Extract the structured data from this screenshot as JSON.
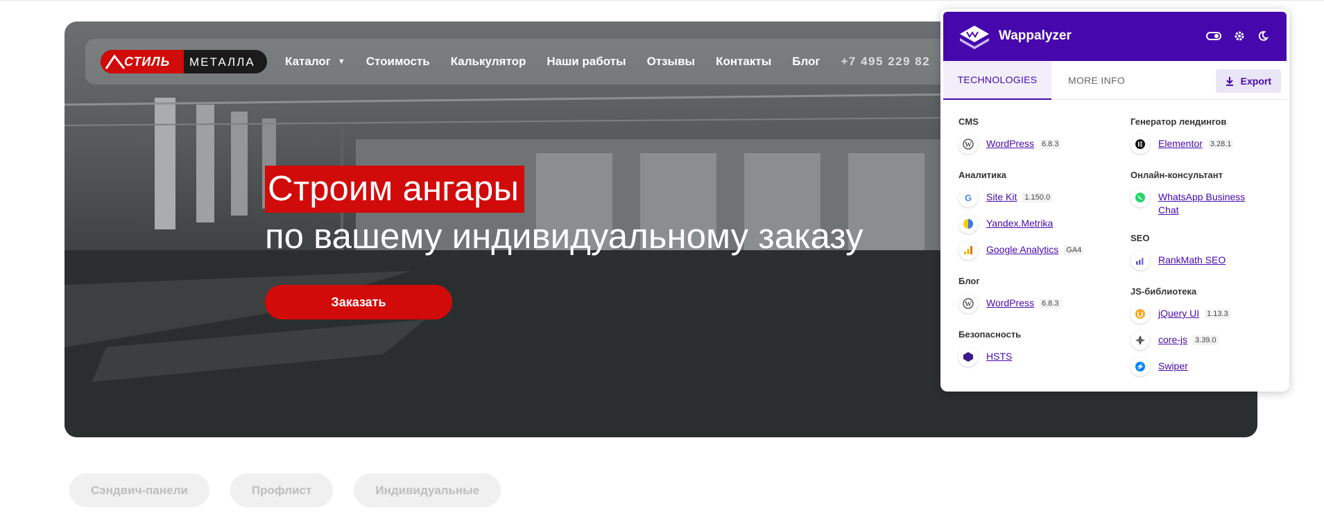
{
  "site": {
    "logo": {
      "part1": "СТИЛЬ",
      "part2": "МЕТАЛЛА"
    },
    "nav": [
      {
        "label": "Каталог",
        "has_dropdown": true
      },
      {
        "label": "Стоимость"
      },
      {
        "label": "Калькулятор"
      },
      {
        "label": "Наши работы"
      },
      {
        "label": "Отзывы"
      },
      {
        "label": "Контакты"
      },
      {
        "label": "Блог"
      }
    ],
    "phone": "+7 495 229 82",
    "headline_line1": "Строим ангары",
    "headline_line2": "по вашему индивидуальному заказу",
    "order_button": "Заказать",
    "chips": [
      "Сэндвич-панели",
      "Профлист",
      "Индивидуальные"
    ],
    "colors": {
      "brand_red": "#d10a0a",
      "dark": "#1b1b1b"
    }
  },
  "wappalyzer": {
    "title": "Wappalyzer",
    "header_icons": [
      "toggle-icon",
      "gear-icon",
      "moon-icon"
    ],
    "tabs": {
      "technologies": "TECHNOLOGIES",
      "more_info": "MORE INFO"
    },
    "export_label": "Export",
    "accent": "#4608ad",
    "left_column": [
      {
        "category": "CMS",
        "items": [
          {
            "name": "WordPress",
            "version": "6.8.3",
            "icon": "wordpress-icon"
          }
        ]
      },
      {
        "category": "Аналитика",
        "items": [
          {
            "name": "Site Kit",
            "version": "1.150.0",
            "icon": "google-icon"
          },
          {
            "name": "Yandex.Metrika",
            "version": "",
            "icon": "yandex-metrika-icon"
          },
          {
            "name": "Google Analytics",
            "version": "GA4",
            "icon": "google-analytics-icon"
          }
        ]
      },
      {
        "category": "Блог",
        "items": [
          {
            "name": "WordPress",
            "version": "6.8.3",
            "icon": "wordpress-icon"
          }
        ]
      },
      {
        "category": "Безопасность",
        "items": [
          {
            "name": "HSTS",
            "version": "",
            "icon": "hsts-icon"
          }
        ]
      }
    ],
    "right_column": [
      {
        "category": "Генератор лендингов",
        "items": [
          {
            "name": "Elementor",
            "version": "3.28.1",
            "icon": "elementor-icon"
          }
        ]
      },
      {
        "category": "Онлайн-консультант",
        "items": [
          {
            "name": "WhatsApp Business Chat",
            "version": "",
            "icon": "whatsapp-icon"
          }
        ]
      },
      {
        "category": "SEO",
        "items": [
          {
            "name": "RankMath SEO",
            "version": "",
            "icon": "rankmath-icon"
          }
        ]
      },
      {
        "category": "JS-библиотека",
        "items": [
          {
            "name": "jQuery UI",
            "version": "1.13.3",
            "icon": "jquery-ui-icon"
          },
          {
            "name": "core-js",
            "version": "3.39.0",
            "icon": "core-js-icon"
          },
          {
            "name": "Swiper",
            "version": "",
            "icon": "swiper-icon"
          }
        ]
      }
    ]
  }
}
